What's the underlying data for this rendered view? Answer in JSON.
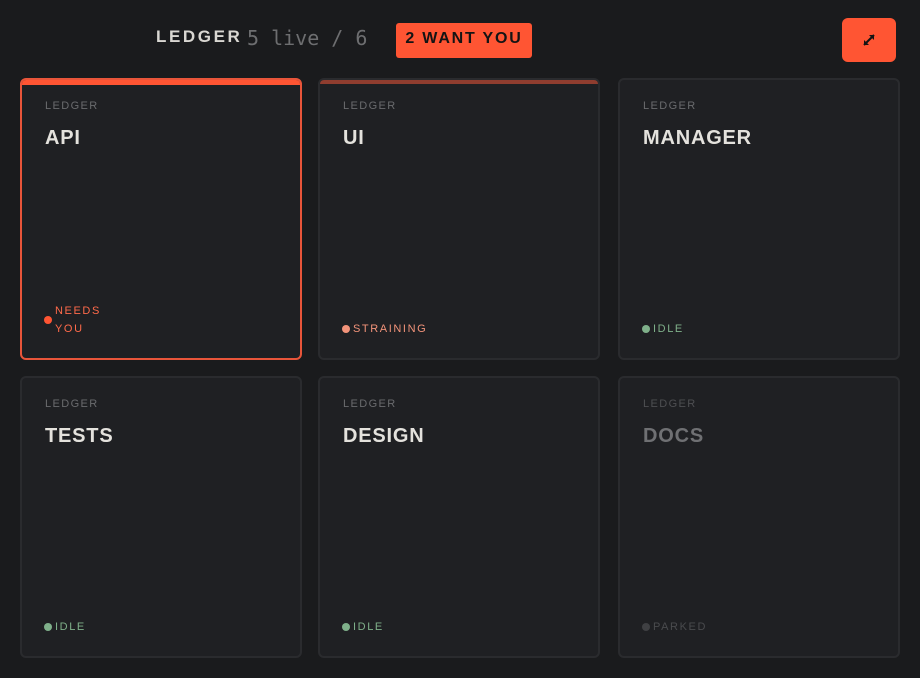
{
  "header": {
    "brand": "LEDGER",
    "live_count": "5 live / 6",
    "want_badge": "2 WANT YOU",
    "expand_icon": "expand-arrows-icon"
  },
  "colors": {
    "accent": "#ff5533",
    "background": "#1a1b1d",
    "card": "#1f2023",
    "needs_you": "#ff6a4a",
    "straining": "#f2937a",
    "idle": "#7fb08a",
    "parked": "#3f4043"
  },
  "cards": [
    {
      "project": "LEDGER",
      "name": "API",
      "status": "NEEDS YOU",
      "state": "needs_you"
    },
    {
      "project": "LEDGER",
      "name": "UI",
      "status": "STRAINING",
      "state": "straining"
    },
    {
      "project": "LEDGER",
      "name": "MANAGER",
      "status": "IDLE",
      "state": "idle"
    },
    {
      "project": "LEDGER",
      "name": "TESTS",
      "status": "IDLE",
      "state": "idle"
    },
    {
      "project": "LEDGER",
      "name": "DESIGN",
      "status": "IDLE",
      "state": "idle"
    },
    {
      "project": "LEDGER",
      "name": "DOCS",
      "status": "PARKED",
      "state": "parked"
    }
  ]
}
